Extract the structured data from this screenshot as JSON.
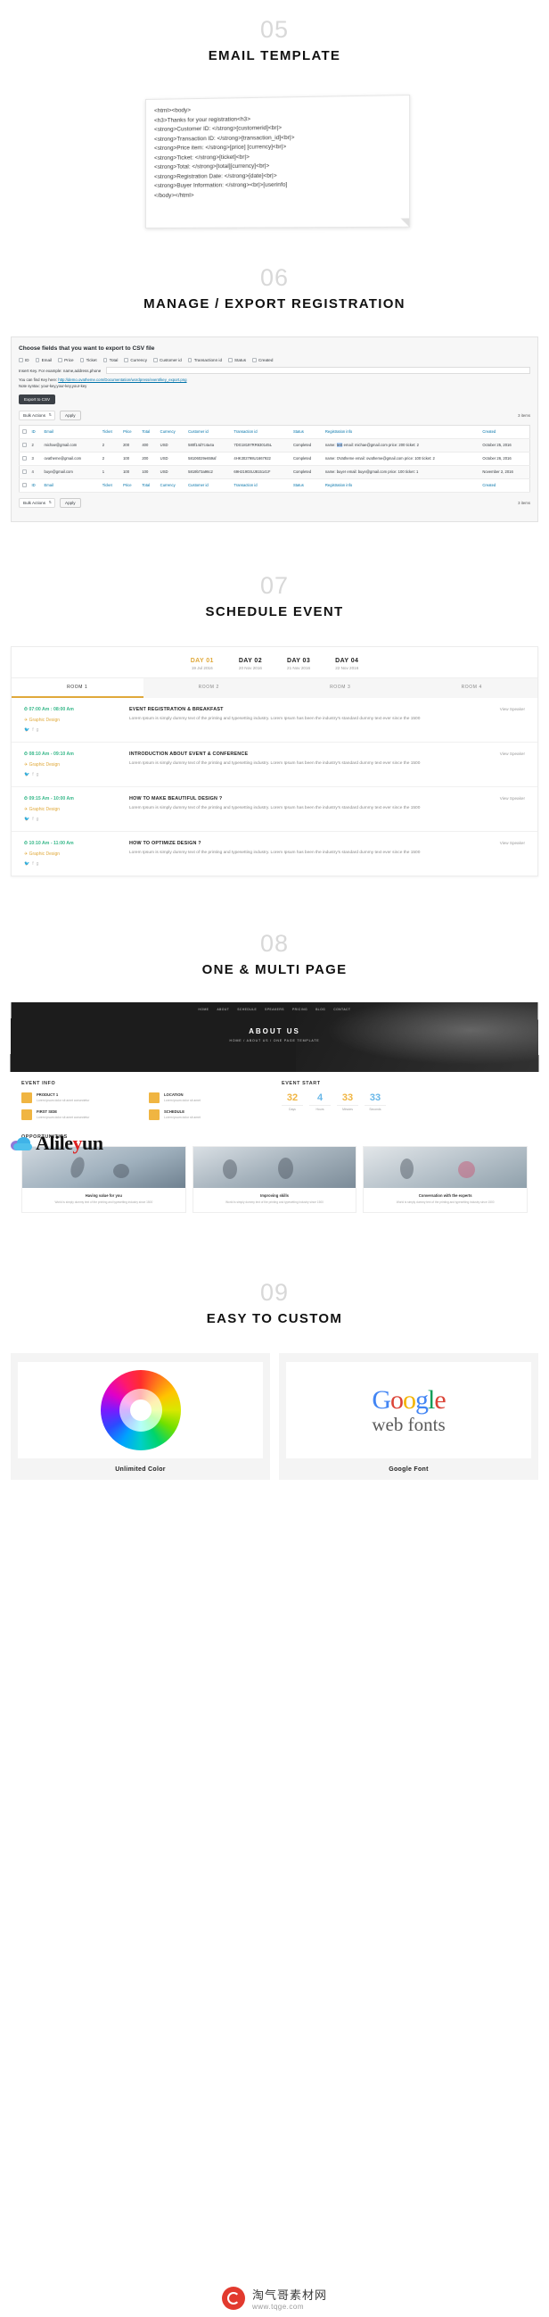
{
  "sections": {
    "email_template": {
      "number": "05",
      "title": "EMAIL TEMPLATE",
      "code_lines": [
        "<html><body>",
        "<h3>Thanks for your registration<h3>",
        "<strong>Customer ID: </strong>[customerid]<br|>",
        "<strong>Transaction ID: </strong>[transaction_id]<br|>",
        "<strong>Price item: </strong>[price] [currency]<br|>",
        "<strong>Ticket: </strong>[ticket]<br|>",
        "<strong>Total: </strong>[total][currency]<br|>",
        "<strong>Registration Date: </strong>[date]<br|>",
        "<strong>Buyer Information: </strong><br|>[userinfo]",
        "</body></html>"
      ]
    },
    "export_registration": {
      "number": "06",
      "title": "MANAGE / EXPORT REGISTRATION",
      "panel_title": "Choose fields that you want to export to CSV file",
      "fields": [
        "ID",
        "Email",
        "Price",
        "Ticket",
        "Total",
        "Currency",
        "Customer id",
        "Transactionn id",
        "Status",
        "Created"
      ],
      "key_label": "Insert Key. For example: name,address,phone",
      "key_value": "",
      "key_placeholder": "",
      "hint_prefix": "You can find Key here: ",
      "hint_link": "http://demo.ovatheme.com/Documentation/wordpress/event/key_export.png",
      "note": "Note syntax: your-key,your-key,your-key",
      "export_button": "Export to CSV",
      "bulk_select": "Bulk Actions",
      "apply_button": "Apply",
      "items_count": "3 items",
      "columns": [
        "ID",
        "Email",
        "Ticket",
        "Price",
        "Total",
        "Currency",
        "Customer id",
        "Transaction id",
        "Status",
        "Registration info",
        "Created"
      ],
      "rows": [
        {
          "id": "2",
          "email": "michae@gmail.com",
          "ticket": "2",
          "price": "200",
          "total": "400",
          "currency": "USD",
          "customer_id": "580f14d7c4a4a",
          "transaction_id": "7DG18197RR630145L",
          "status": "Completed",
          "reg_info_prefix": "name: ",
          "reg_info_highlight": "test",
          "reg_info_rest": "email: michae@gmail.com price: 200 ticket: 2",
          "created": "October 25, 2016"
        },
        {
          "id": "3",
          "email": "ovatheme@gmail.com",
          "ticket": "2",
          "price": "100",
          "total": "200",
          "currency": "USD",
          "customer_id": "58106029e659af",
          "transaction_id": "4HK302798U1667922",
          "status": "Completed",
          "reg_info_prefix": "name: ",
          "reg_info_highlight": "OVatheme",
          "reg_info_rest": "email: ovatheme@gmail.com price: 100 ticket: 2",
          "created": "October 26, 2016"
        },
        {
          "id": "4",
          "email": "buye@gmail.com",
          "ticket": "1",
          "price": "100",
          "total": "100",
          "currency": "USD",
          "customer_id": "5819b73a96c2",
          "transaction_id": "69H21903UJ815141F",
          "status": "Completed",
          "reg_info_prefix": "name: ",
          "reg_info_highlight": "buyer",
          "reg_info_rest": "email: buye@gmail.com price: 100 ticket: 1",
          "created": "November 2, 2016"
        }
      ],
      "footer_count": "3 items"
    },
    "schedule_event": {
      "number": "07",
      "title": "SCHEDULE EVENT",
      "days": [
        {
          "label": "DAY 01",
          "date": "19 Jul 2016",
          "active": true
        },
        {
          "label": "DAY 02",
          "date": "20 Nov 2016",
          "active": false
        },
        {
          "label": "DAY 03",
          "date": "21 Nov 2016",
          "active": false
        },
        {
          "label": "DAY 04",
          "date": "22 Nov 2016",
          "active": false
        }
      ],
      "rooms": [
        {
          "label": "ROOM 1",
          "active": true
        },
        {
          "label": "ROOM 2",
          "active": false
        },
        {
          "label": "ROOM 3",
          "active": false
        },
        {
          "label": "ROOM 4",
          "active": false
        }
      ],
      "events": [
        {
          "time": "07:00 Am : 08:00 Am",
          "category": "Graphic Design",
          "title": "EVENT REGISTRATION & BREAKFAST",
          "desc": "Lorem Ipsum is simply dummy text of the printing and typesetting industry. Lorem Ipsum has been the industry's standard dummy text ever since the 1500",
          "speaker": "View Speaker"
        },
        {
          "time": "08:10 Am - 09:10 Am",
          "category": "Graphic Design",
          "title": "INTRODUCTION ABOUT EVENT & CONFERENCE",
          "desc": "Lorem Ipsum is simply dummy text of the printing and typesetting industry. Lorem Ipsum has been the industry's standard dummy text ever since the 1500",
          "speaker": "View Speaker"
        },
        {
          "time": "09:15 Am - 10:00 Am",
          "category": "Graphic Design",
          "title": "HOW TO MAKE BEAUTIFUL DESIGN ?",
          "desc": "Lorem Ipsum is simply dummy text of the printing and typesetting industry. Lorem Ipsum has been the industry's standard dummy text ever since the 1500",
          "speaker": "View Speaker"
        },
        {
          "time": "10:10 Am - 11:00 Am",
          "category": "Graphic Design",
          "title": "HOW TO OPTIMIZE DESIGN ?",
          "desc": "Lorem Ipsum is simply dummy text of the printing and typesetting industry. Lorem Ipsum has been the industry's standard dummy text ever since the 1500",
          "speaker": "View Speaker"
        }
      ]
    },
    "one_multi_page": {
      "number": "08",
      "title": "ONE & MULTI PAGE",
      "hero_title": "ABOUT US",
      "hero_sub": "HOME / ABOUT US / ONE PAGE TEMPLATE",
      "hero_nav": [
        "HOME",
        "ABOUT",
        "SCHEDULE",
        "SPEAKERS",
        "PRICING",
        "BLOG",
        "CONTACT"
      ],
      "event_info_heading": "EVENT INFO",
      "event_start_heading": "EVENT START",
      "info_items": [
        {
          "title": "PRODUCT 1",
          "sub": "Lorem ipsum dolor sit amet consectetur"
        },
        {
          "title": "FIRST SIDE",
          "sub": "Lorem ipsum dolor sit amet consectetur"
        },
        {
          "title": "LOCATION",
          "sub": "Lorem ipsum dolor sit amet"
        },
        {
          "title": "SCHEDULE",
          "sub": "Lorem ipsum dolor sit amet"
        }
      ],
      "countdown": [
        {
          "value": "32",
          "label": "Days"
        },
        {
          "value": "4",
          "label": "Hours"
        },
        {
          "value": "33",
          "label": "Minutes"
        },
        {
          "value": "33",
          "label": "Seconds"
        }
      ],
      "opportunities_heading": "OPPORTUNITIES",
      "opportunities": [
        {
          "title": "Having value for you",
          "desc": "World is simply dummy text of the printing and typesetting industry since 1500"
        },
        {
          "title": "Improving skills",
          "desc": "World is simply dummy text of the printing and typesetting industry since 1500"
        },
        {
          "title": "Conversation with the experts",
          "desc": "World is simply dummy text of the printing and typesetting industry since 1500"
        }
      ]
    },
    "easy_custom": {
      "number": "09",
      "title": "EASY TO CUSTOM",
      "items": [
        {
          "caption": "Unlimited Color"
        },
        {
          "caption": "Google Font"
        }
      ],
      "google_word": "Google",
      "google_sub": "web fonts"
    }
  },
  "logo": {
    "text_left": "Alile",
    "text_y": "y",
    "text_right": "un"
  },
  "watermark": {
    "site_cn": "淘气哥素材网",
    "site_url": "www.tqge.com"
  },
  "colors": {
    "accent_gold": "#e0a93b",
    "accent_green": "#38b88a",
    "link_blue": "#0073aa",
    "highlight": "#b3d4fc"
  }
}
